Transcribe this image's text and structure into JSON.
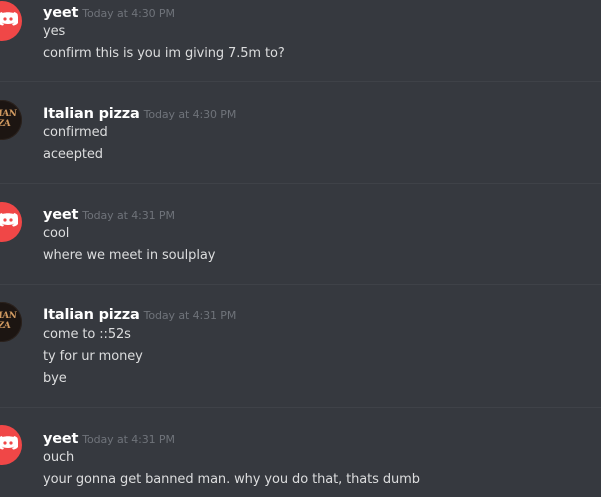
{
  "messages": [
    {
      "author": "yeet",
      "avatar": "discord-logo-icon",
      "timestamp": "Today at 4:30 PM",
      "lines": [
        "yes",
        "confirm this is you im giving 7.5m to?"
      ]
    },
    {
      "author": "Italian pizza",
      "avatar": "italian-pizza-avatar",
      "avatar_text": "LIAN ZZA",
      "timestamp": "Today at 4:30 PM",
      "lines": [
        "confirmed",
        "aceepted"
      ]
    },
    {
      "author": "yeet",
      "avatar": "discord-logo-icon",
      "timestamp": "Today at 4:31 PM",
      "lines": [
        "cool",
        "where we meet in soulplay"
      ]
    },
    {
      "author": "Italian pizza",
      "avatar": "italian-pizza-avatar",
      "avatar_text": "LIAN ZZA",
      "timestamp": "Today at 4:31 PM",
      "lines": [
        "come to ::52s",
        "ty for ur money",
        "bye"
      ]
    },
    {
      "author": "yeet",
      "avatar": "discord-logo-icon",
      "timestamp": "Today at 4:31 PM",
      "lines": [
        "ouch",
        "your gonna get banned man. why you do that, thats dumb"
      ]
    }
  ],
  "colors": {
    "background": "#36393f",
    "username": "#ffffff",
    "timestamp": "#72767d",
    "message_text": "#dcddde",
    "discord_avatar": "#f04747",
    "divider": "#3f4248"
  }
}
